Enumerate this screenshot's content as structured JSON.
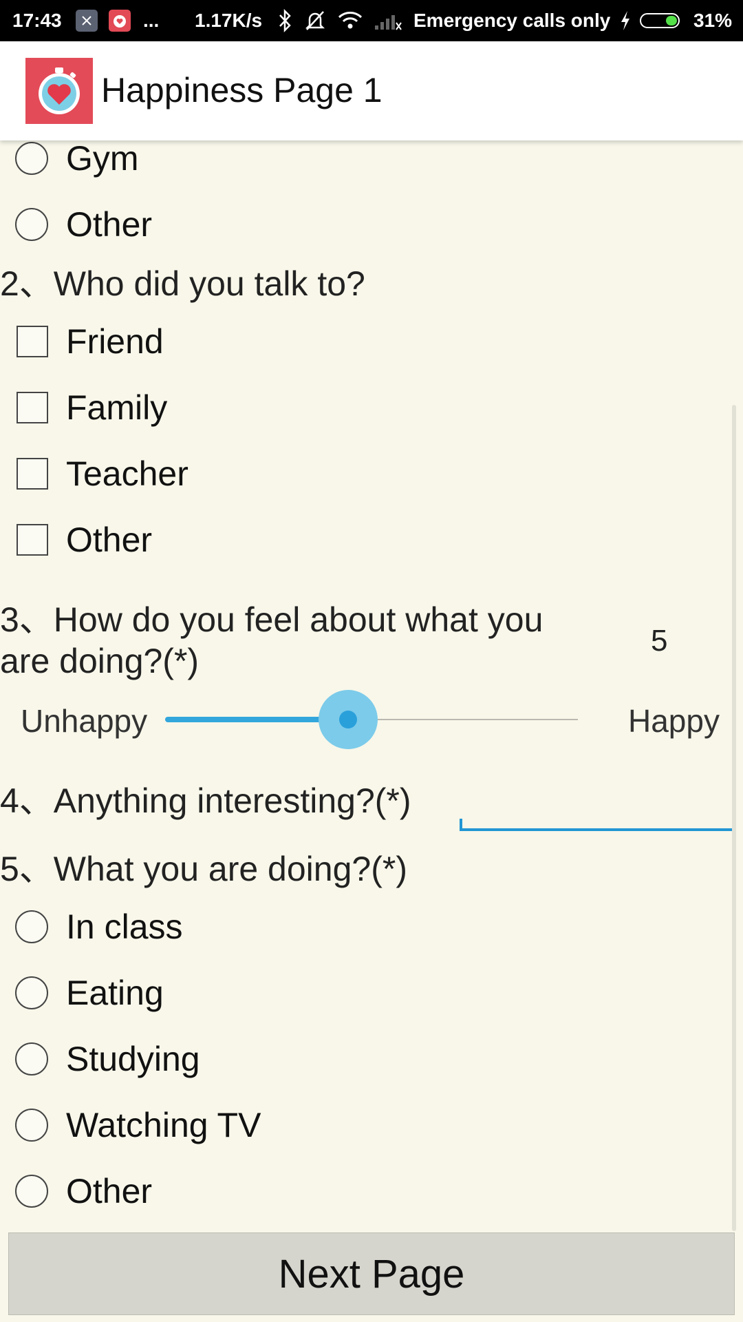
{
  "status_bar": {
    "time": "17:43",
    "more": "...",
    "speed": "1.17K/s",
    "carrier": "Emergency calls only",
    "battery": "31%",
    "icons": [
      "app-notification-icon",
      "stopwatch-app-icon",
      "bluetooth-icon",
      "silent-icon",
      "wifi-icon",
      "signal-icon",
      "charging-icon",
      "battery-icon"
    ]
  },
  "app_bar": {
    "title": "Happiness Page 1",
    "logo_icon": "stopwatch-heart-icon"
  },
  "q1": {
    "options": [
      {
        "label": "Gym",
        "selected": false
      },
      {
        "label": "Other",
        "selected": false
      }
    ]
  },
  "q2": {
    "question": "2、Who did you talk to?",
    "options": [
      {
        "label": "Friend",
        "checked": false
      },
      {
        "label": "Family",
        "checked": false
      },
      {
        "label": "Teacher",
        "checked": false
      },
      {
        "label": "Other",
        "checked": false
      }
    ]
  },
  "q3": {
    "question_line1": "3、How do you feel about what you",
    "question_line2": "are doing?(*)",
    "value": "5",
    "min_label": "Unhappy",
    "max_label": "Happy",
    "slider_fraction": 0.44
  },
  "q4": {
    "question": "4、Anything interesting?(*)",
    "value": ""
  },
  "q5": {
    "question": "5、What you are doing?(*)",
    "options": [
      {
        "label": "In class",
        "selected": false
      },
      {
        "label": "Eating",
        "selected": false
      },
      {
        "label": "Studying",
        "selected": false
      },
      {
        "label": "Watching TV",
        "selected": false
      },
      {
        "label": "Other",
        "selected": false
      }
    ]
  },
  "next_button": "Next Page",
  "colors": {
    "background": "#f8f7ea",
    "accent": "#2aa0db",
    "app_icon": "#e34b58"
  }
}
